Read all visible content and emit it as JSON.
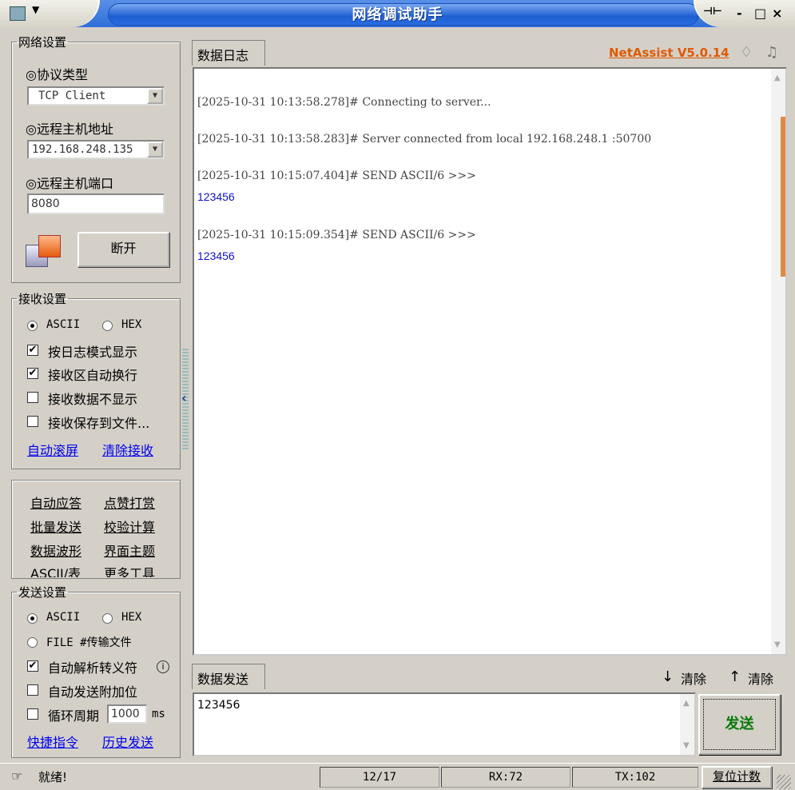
{
  "window": {
    "title": "网络调试助手",
    "controls": {
      "pin": "⊣⊢",
      "minimize": "-",
      "maximize": "□",
      "close": "×"
    }
  },
  "network": {
    "legend": "网络设置",
    "protocol_label": "◎协议类型",
    "protocol_value": "TCP Client",
    "host_label": "◎远程主机地址",
    "host_value": "192.168.248.135",
    "port_label": "◎远程主机端口",
    "port_value": "8080",
    "disconnect_label": "断开"
  },
  "receive": {
    "legend": "接收设置",
    "ascii_label": "ASCII",
    "hex_label": "HEX",
    "options": [
      {
        "label": "按日志模式显示",
        "checked": true
      },
      {
        "label": "接收区自动换行",
        "checked": true
      },
      {
        "label": "接收数据不显示",
        "checked": false
      },
      {
        "label": "接收保存到文件...",
        "checked": false
      }
    ],
    "auto_scroll": "自动滚屏",
    "clear_recv": "清除接收"
  },
  "tools": {
    "items": [
      [
        "自动应答",
        "点赞打赏"
      ],
      [
        "批量发送",
        "校验计算"
      ],
      [
        "数据波形",
        "界面主题"
      ],
      [
        "ASCII/表",
        "更多工具"
      ]
    ]
  },
  "send_settings": {
    "legend": "发送设置",
    "ascii_label": "ASCII",
    "hex_label": "HEX",
    "file_label": "FILE #传输文件",
    "auto_escape": "自动解析转义符",
    "append_bit": "自动发送附加位",
    "loop_label": "循环周期",
    "loop_value": "1000",
    "loop_unit": "ms",
    "shortcuts": "快捷指令",
    "history": "历史发送"
  },
  "log": {
    "tab": "数据日志",
    "brand": "NetAssist V5.0.14",
    "entries": [
      {
        "header": "[2025-10-31 10:13:58.278]# Connecting to server...",
        "data": ""
      },
      {
        "header": "[2025-10-31 10:13:58.283]# Server connected from local 192.168.248.1 :50700",
        "data": ""
      },
      {
        "header": "[2025-10-31 10:15:07.404]# SEND ASCII/6 >>>",
        "data": "123456"
      },
      {
        "header": "[2025-10-31 10:15:09.354]# SEND ASCII/6 >>>",
        "data": "123456"
      }
    ]
  },
  "send": {
    "tab": "数据发送",
    "clear1": "清除",
    "clear2": "清除",
    "text": "123456",
    "button": "发送"
  },
  "status": {
    "ready": "就绪!",
    "progress": "12/17",
    "rx": "RX:72",
    "tx": "TX:102",
    "reset": "复位计数"
  }
}
